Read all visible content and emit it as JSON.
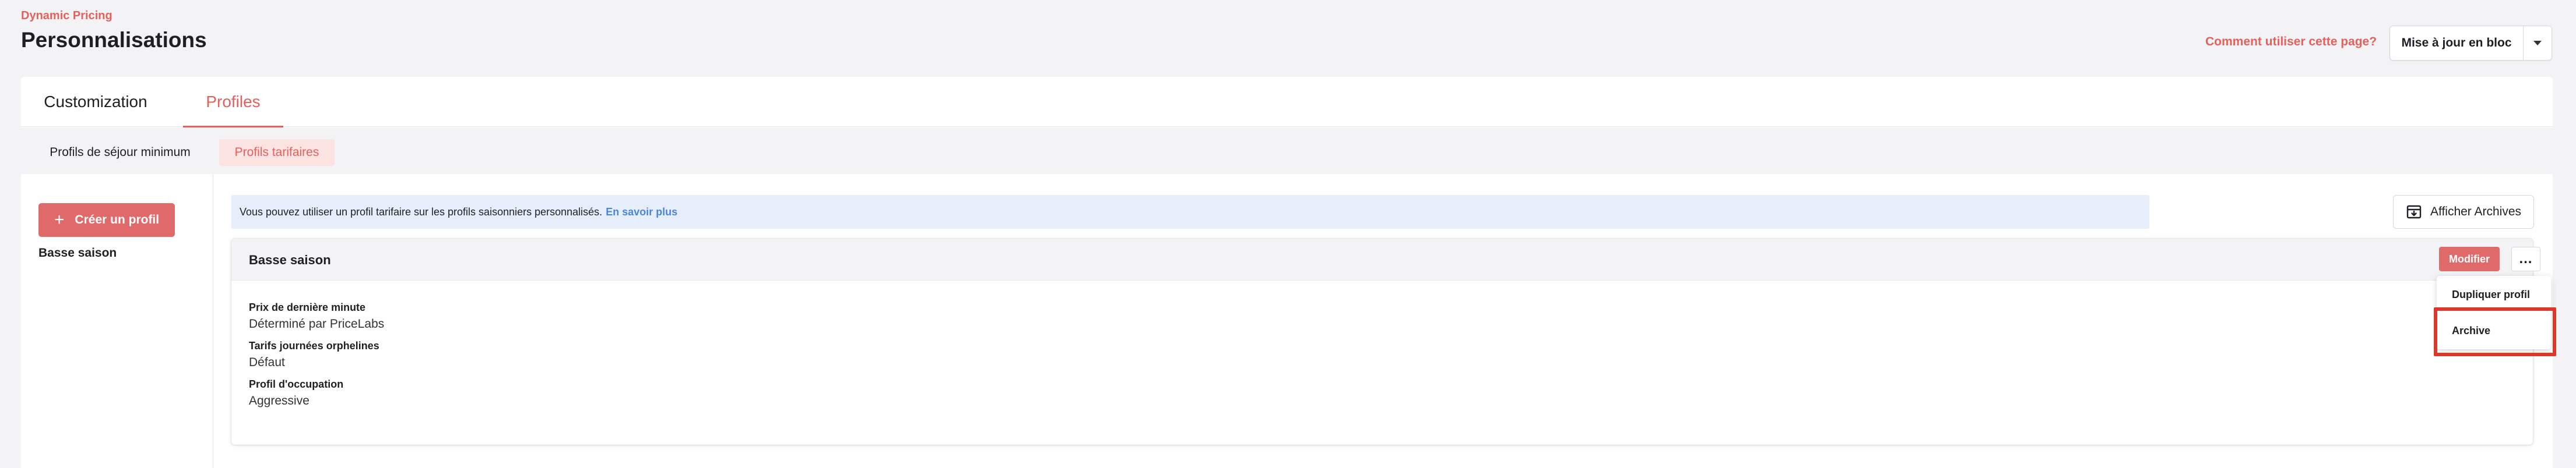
{
  "header": {
    "eyebrow": "Dynamic Pricing",
    "title": "Personnalisations",
    "help_link": "Comment utiliser cette page?",
    "bulk_update_label": "Mise à jour en bloc"
  },
  "tabs": [
    {
      "label": "Customization",
      "active": false
    },
    {
      "label": "Profiles",
      "active": true
    }
  ],
  "subtabs": [
    {
      "label": "Profils de séjour minimum",
      "active": false
    },
    {
      "label": "Profils tarifaires",
      "active": true
    }
  ],
  "sidebar": {
    "create_label": "Créer un profil",
    "items": [
      {
        "label": "Basse saison"
      }
    ]
  },
  "banner": {
    "text": "Vous pouvez utiliser un profil tarifaire sur les profils saisonniers personnalisés.",
    "link": "En savoir plus"
  },
  "archives_button": "Afficher Archives",
  "profile_card": {
    "title": "Basse saison",
    "modify_label": "Modifier",
    "more_label": "…",
    "fields": [
      {
        "label": "Prix de dernière minute",
        "value": "Déterminé par PriceLabs"
      },
      {
        "label": "Tarifs journées orphelines",
        "value": "Défaut"
      },
      {
        "label": "Profil d'occupation",
        "value": "Aggressive"
      }
    ],
    "menu": [
      {
        "label": "Dupliquer profil"
      },
      {
        "label": "Archive"
      }
    ]
  },
  "colors": {
    "accent": "#e5605b",
    "button_fill": "#e0696a",
    "highlight": "#d93a2c",
    "banner_bg": "#e6eefb",
    "link_blue": "#4a86d8"
  }
}
